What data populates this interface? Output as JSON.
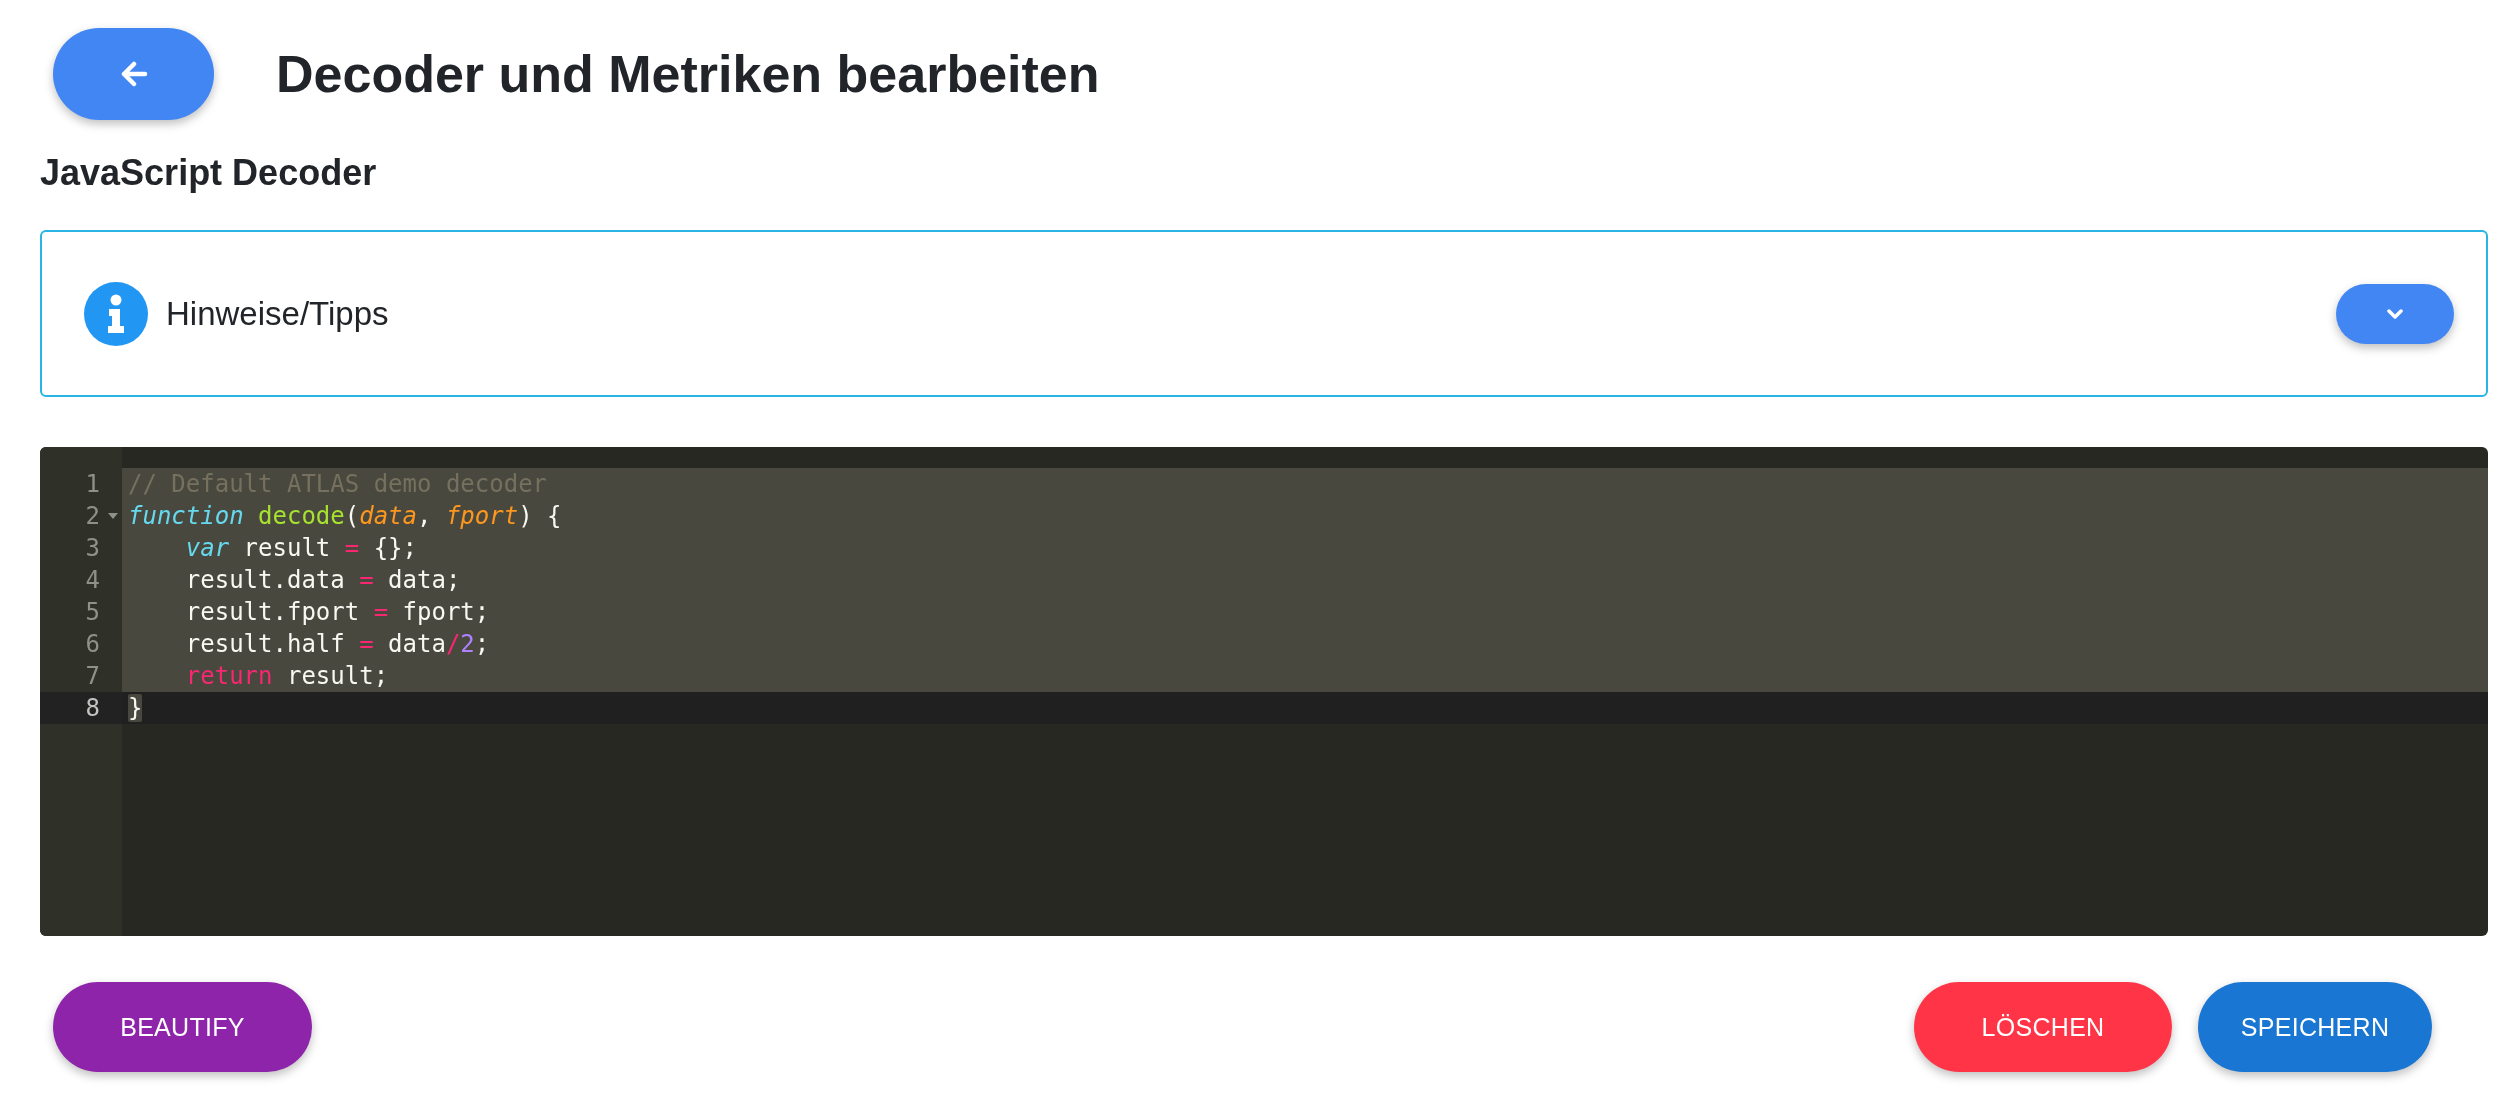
{
  "header": {
    "title": "Decoder und Metriken bearbeiten"
  },
  "section_title": "JavaScript Decoder",
  "hints_panel": {
    "label": "Hinweise/Tipps",
    "expanded": false
  },
  "editor": {
    "lines": [
      {
        "number": "1",
        "foldable": false,
        "indented": false,
        "selected": true,
        "active": false,
        "tokens": [
          {
            "kind": "comment",
            "text": "// Default ATLAS demo decoder"
          }
        ]
      },
      {
        "number": "2",
        "foldable": true,
        "indented": false,
        "selected": true,
        "active": false,
        "tokens": [
          {
            "kind": "storage",
            "text": "function"
          },
          {
            "kind": "entity",
            "text": " decode"
          },
          {
            "kind": "plain",
            "text": "("
          },
          {
            "kind": "param",
            "text": "data"
          },
          {
            "kind": "plain",
            "text": ", "
          },
          {
            "kind": "param",
            "text": "fport"
          },
          {
            "kind": "plain",
            "text": ") {"
          }
        ]
      },
      {
        "number": "3",
        "foldable": false,
        "indented": true,
        "selected": true,
        "active": false,
        "tokens": [
          {
            "kind": "storage",
            "text": "var"
          },
          {
            "kind": "plain",
            "text": " result "
          },
          {
            "kind": "operator",
            "text": "="
          },
          {
            "kind": "plain",
            "text": " {};"
          }
        ]
      },
      {
        "number": "4",
        "foldable": false,
        "indented": true,
        "selected": true,
        "active": false,
        "tokens": [
          {
            "kind": "plain",
            "text": "result.data "
          },
          {
            "kind": "operator",
            "text": "="
          },
          {
            "kind": "plain",
            "text": " data;"
          }
        ]
      },
      {
        "number": "5",
        "foldable": false,
        "indented": true,
        "selected": true,
        "active": false,
        "tokens": [
          {
            "kind": "plain",
            "text": "result.fport "
          },
          {
            "kind": "operator",
            "text": "="
          },
          {
            "kind": "plain",
            "text": " fport;"
          }
        ]
      },
      {
        "number": "6",
        "foldable": false,
        "indented": true,
        "selected": true,
        "active": false,
        "tokens": [
          {
            "kind": "plain",
            "text": "result.half "
          },
          {
            "kind": "operator",
            "text": "="
          },
          {
            "kind": "plain",
            "text": " data"
          },
          {
            "kind": "operator",
            "text": "/"
          },
          {
            "kind": "number",
            "text": "2"
          },
          {
            "kind": "plain",
            "text": ";"
          }
        ]
      },
      {
        "number": "7",
        "foldable": false,
        "indented": true,
        "selected": true,
        "active": false,
        "tokens": [
          {
            "kind": "keyword",
            "text": "return"
          },
          {
            "kind": "plain",
            "text": " result;"
          }
        ]
      },
      {
        "number": "8",
        "foldable": false,
        "indented": false,
        "selected": false,
        "active": true,
        "tokens": [
          {
            "kind": "selected-plain",
            "text": "}"
          }
        ]
      }
    ]
  },
  "actions": [
    {
      "label": "BEAUTIFY",
      "kind": "beautify"
    },
    {
      "label": "LÖSCHEN",
      "kind": "delete"
    },
    {
      "label": "SPEICHERN",
      "kind": "save"
    }
  ]
}
